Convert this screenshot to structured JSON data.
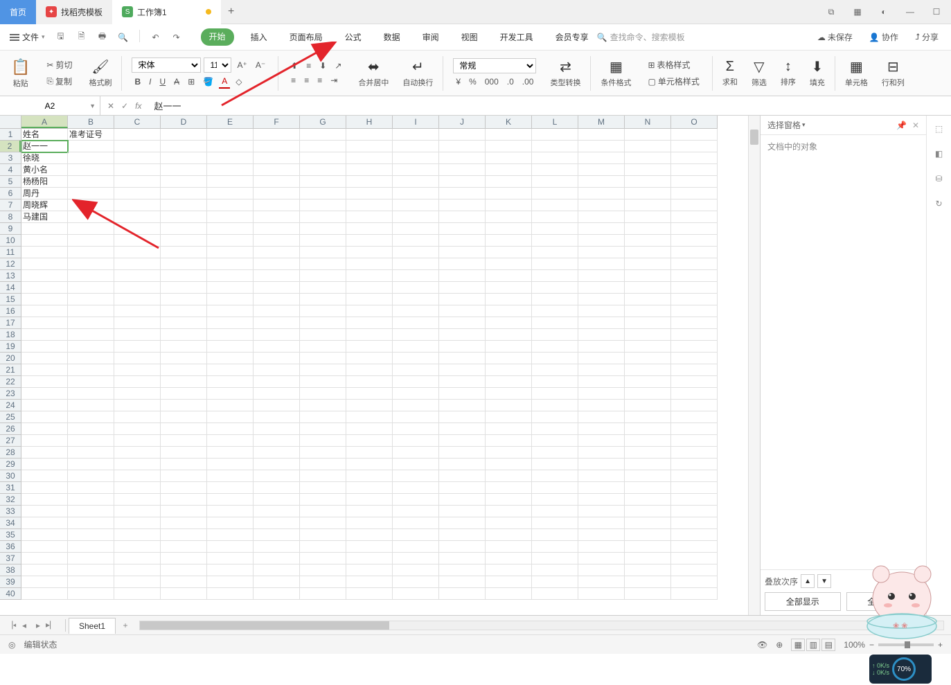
{
  "titlebar": {
    "tabs": [
      {
        "label": "首页",
        "type": "home"
      },
      {
        "label": "找稻壳模板",
        "type": "template"
      },
      {
        "label": "工作簿1",
        "type": "active",
        "dirty": true
      }
    ]
  },
  "menubar": {
    "file": "文件",
    "tabs": [
      "开始",
      "插入",
      "页面布局",
      "公式",
      "数据",
      "审阅",
      "视图",
      "开发工具",
      "会员专享"
    ],
    "active_tab": 0,
    "search_placeholder": "查找命令、搜索模板",
    "right": {
      "unsaved": "未保存",
      "collab": "协作",
      "share": "分享"
    }
  },
  "toolbar": {
    "paste": "粘贴",
    "cut": "剪切",
    "copy": "复制",
    "format_painter": "格式刷",
    "font_name": "宋体",
    "font_size": "11",
    "merge": "合并居中",
    "wrap": "自动换行",
    "number_format": "常规",
    "type_convert": "类型转换",
    "cond_format": "条件格式",
    "table_style": "表格样式",
    "cell_style": "单元格样式",
    "sum": "求和",
    "filter": "筛选",
    "sort": "排序",
    "fill": "填充",
    "cell": "单元格",
    "row_col": "行和列"
  },
  "namebox": {
    "ref": "A2",
    "formula": "赵一一"
  },
  "columns": [
    "A",
    "B",
    "C",
    "D",
    "E",
    "F",
    "G",
    "H",
    "I",
    "J",
    "K",
    "L",
    "M",
    "N",
    "O"
  ],
  "rows": 40,
  "active_cell": {
    "row": 2,
    "col": 0
  },
  "cells": {
    "0_0": "姓名",
    "0_1": "准考证号",
    "1_0": "赵一一",
    "2_0": "徐晓",
    "3_0": "黄小名",
    "4_0": "杨杨阳",
    "5_0": "周丹",
    "6_0": "周晓辉",
    "7_0": "马建国"
  },
  "side": {
    "title": "选择窗格",
    "subtitle": "文档中的对象",
    "stack": "叠放次序",
    "show_all": "全部显示",
    "hide_all": "全部隐藏"
  },
  "sheettabs": {
    "active": "Sheet1"
  },
  "statusbar": {
    "mode": "编辑状态",
    "zoom": "100%"
  },
  "netwidget": {
    "pct": "70%",
    "up": "0K/s",
    "down": "0K/s"
  }
}
